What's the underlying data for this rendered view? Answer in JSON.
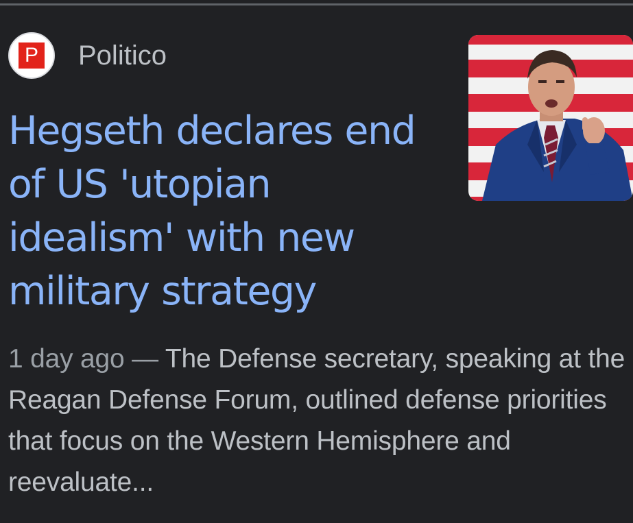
{
  "result": {
    "source": {
      "favicon_letter": "P",
      "favicon_color": "#e2231a",
      "name": "Politico"
    },
    "headline": "Hegseth declares end of US 'utopian idealism' with new military strategy",
    "date": "1 day ago",
    "separator": " — ",
    "snippet": "The Defense secretary, speaking at the Reagan Defense Forum, outlined defense priorities that focus on the Western Hemisphere and reevaluate...",
    "thumbnail_icon": "man-in-suit-flag-photo"
  },
  "colors": {
    "background": "#202124",
    "link": "#8ab4f8",
    "text": "#bdc1c6",
    "muted": "#9aa0a6"
  }
}
